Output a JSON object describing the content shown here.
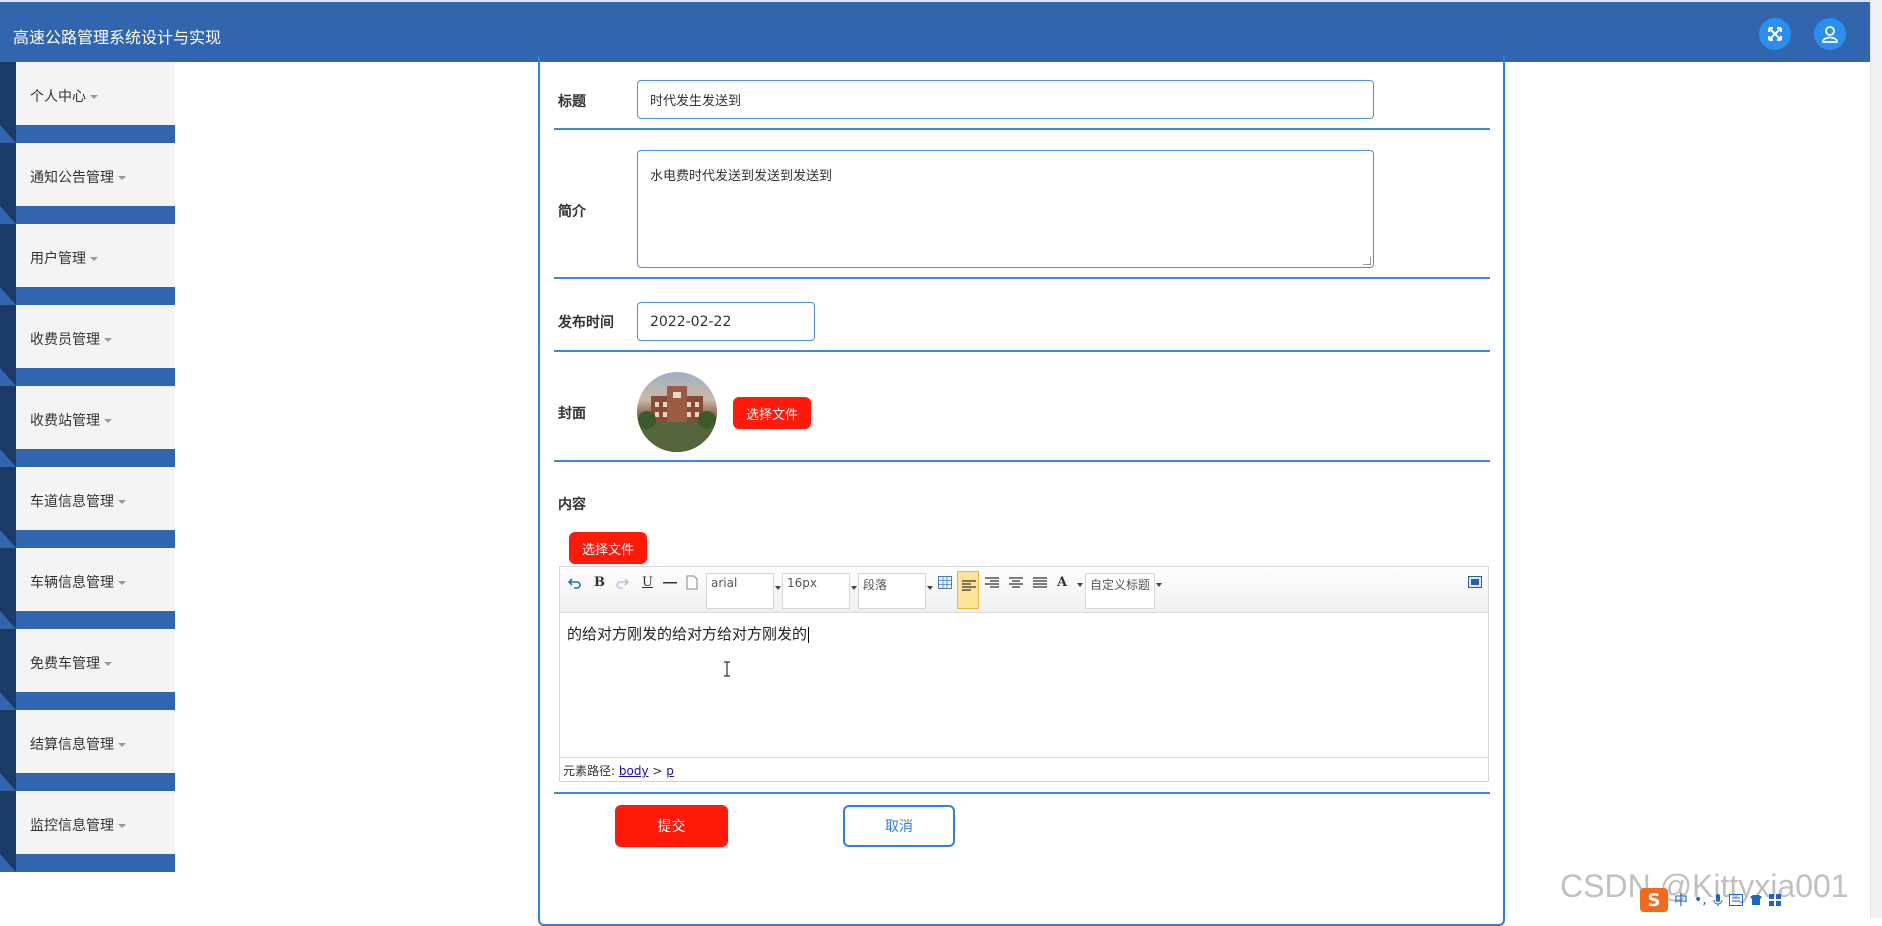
{
  "app": {
    "title": "高速公路管理系统设计与实现"
  },
  "header": {
    "fullscreen_icon": "expand-icon",
    "user_icon": "user-icon"
  },
  "sidebar": {
    "items": [
      {
        "label": "个人中心"
      },
      {
        "label": "通知公告管理"
      },
      {
        "label": "用户管理"
      },
      {
        "label": "收费员管理"
      },
      {
        "label": "收费站管理"
      },
      {
        "label": "车道信息管理"
      },
      {
        "label": "车辆信息管理"
      },
      {
        "label": "免费车管理"
      },
      {
        "label": "结算信息管理"
      },
      {
        "label": "监控信息管理"
      }
    ]
  },
  "form": {
    "title_label": "标题",
    "title_value": "时代发生发送到",
    "intro_label": "简介",
    "intro_value": "水电费时代发送到发送到发送到",
    "date_label": "发布时间",
    "date_value": "2022-02-22",
    "cover_label": "封面",
    "cover_button": "选择文件",
    "content_label": "内容",
    "content_button": "选择文件",
    "submit_label": "提交",
    "cancel_label": "取消"
  },
  "editor": {
    "font_family": "arial",
    "font_size": "16px",
    "paragraph": "段落",
    "custom_heading": "自定义标题",
    "text_color_label": "A",
    "bold_label": "B",
    "underline_label": "U",
    "content": "的给对方刚发的给对方给对方刚发的",
    "path_label": "元素路径:",
    "path_body": "body",
    "path_sep": ">",
    "path_p": "p"
  },
  "watermark": "CSDN @Kittyxia001",
  "ime": {
    "char": "中",
    "logo": "S"
  },
  "colors": {
    "header": "#3166ae",
    "accent": "#2f80e0",
    "danger": "#ff1a0a"
  }
}
